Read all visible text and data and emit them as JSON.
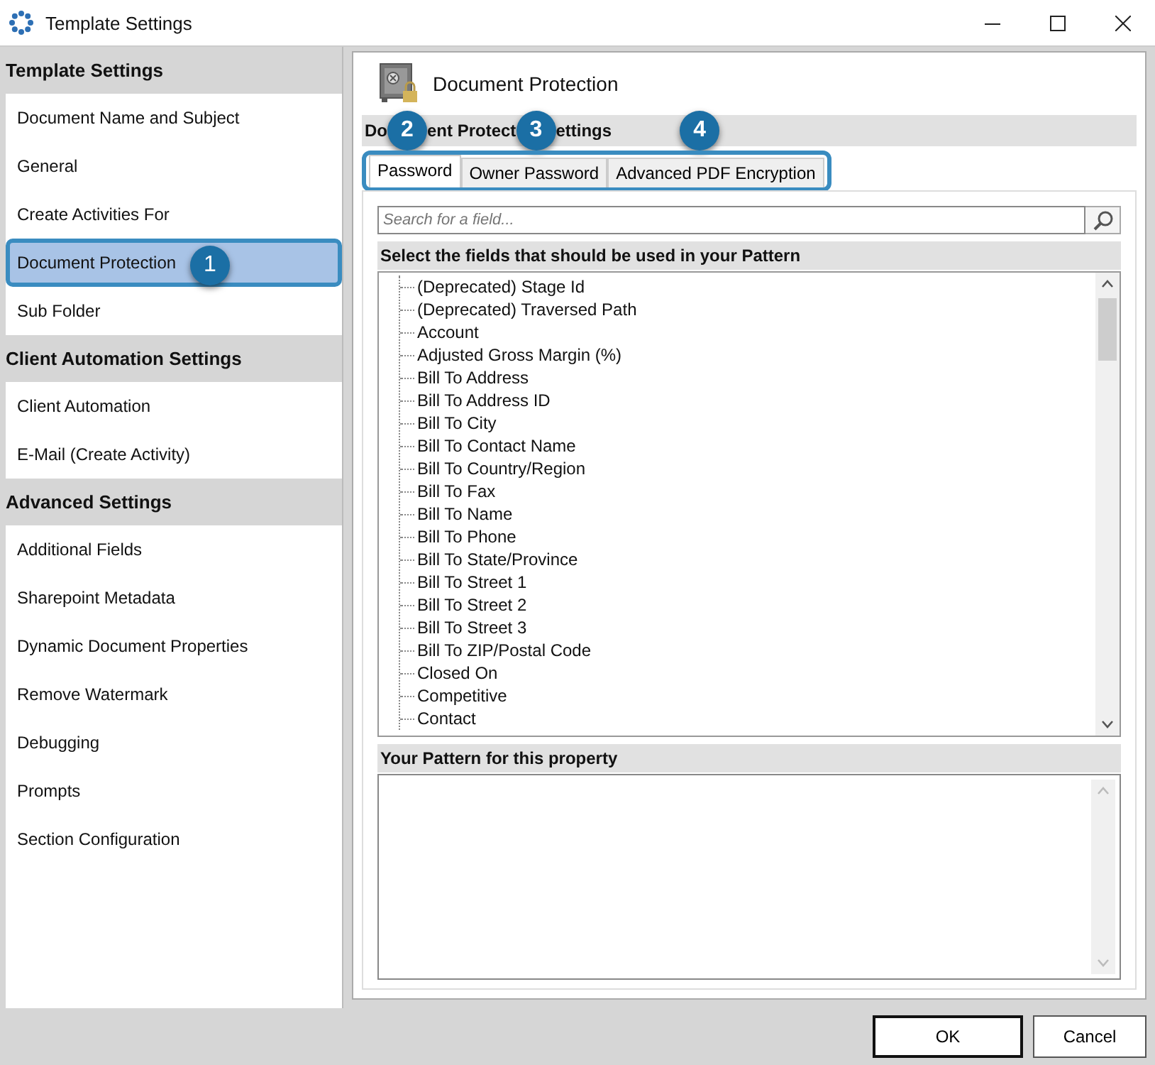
{
  "window": {
    "title": "Template Settings"
  },
  "sidebar": {
    "groups": [
      {
        "title": "Template Settings",
        "items": [
          {
            "label": "Document Name and Subject",
            "selected": false
          },
          {
            "label": "General",
            "selected": false
          },
          {
            "label": "Create Activities For",
            "selected": false
          },
          {
            "label": "Document Protection",
            "selected": true,
            "badge": "1"
          },
          {
            "label": "Sub Folder",
            "selected": false
          }
        ]
      },
      {
        "title": "Client Automation Settings",
        "items": [
          {
            "label": "Client Automation",
            "selected": false
          },
          {
            "label": "E-Mail (Create Activity)",
            "selected": false
          }
        ]
      },
      {
        "title": "Advanced Settings",
        "items": [
          {
            "label": "Additional Fields",
            "selected": false
          },
          {
            "label": "Sharepoint Metadata",
            "selected": false
          },
          {
            "label": "Dynamic Document Properties",
            "selected": false
          },
          {
            "label": "Remove Watermark",
            "selected": false
          },
          {
            "label": "Debugging",
            "selected": false
          },
          {
            "label": "Prompts",
            "selected": false
          },
          {
            "label": "Section Configuration",
            "selected": false
          }
        ]
      }
    ]
  },
  "content": {
    "title": "Document Protection",
    "section_heading": [
      {
        "kind": "text",
        "text": "Do"
      },
      {
        "kind": "badge",
        "text": "2"
      },
      {
        "kind": "text",
        "text": "ent Protect"
      },
      {
        "kind": "badge",
        "text": "3"
      },
      {
        "kind": "text",
        "text": "ettings"
      },
      {
        "kind": "badge",
        "text": "4"
      }
    ],
    "tabs": [
      {
        "label": "Password",
        "selected": true
      },
      {
        "label": "Owner Password",
        "selected": false
      },
      {
        "label": "Advanced PDF Encryption",
        "selected": false
      }
    ],
    "search": {
      "placeholder": "Search for a field..."
    },
    "fields_heading": "Select the fields that should be used in your Pattern",
    "fields": [
      "(Deprecated) Stage Id",
      "(Deprecated) Traversed Path",
      "Account",
      "Adjusted Gross Margin (%)",
      "Bill To Address",
      "Bill To Address ID",
      "Bill To City",
      "Bill To Contact Name",
      "Bill To Country/Region",
      "Bill To Fax",
      "Bill To Name",
      "Bill To Phone",
      "Bill To State/Province",
      "Bill To Street 1",
      "Bill To Street 2",
      "Bill To Street 3",
      "Bill To ZIP/Postal Code",
      "Closed On",
      "Competitive",
      "Contact"
    ],
    "pattern_heading": "Your Pattern for this property"
  },
  "buttons": [
    {
      "label": "OK",
      "default": true
    },
    {
      "label": "Cancel",
      "default": false
    }
  ]
}
